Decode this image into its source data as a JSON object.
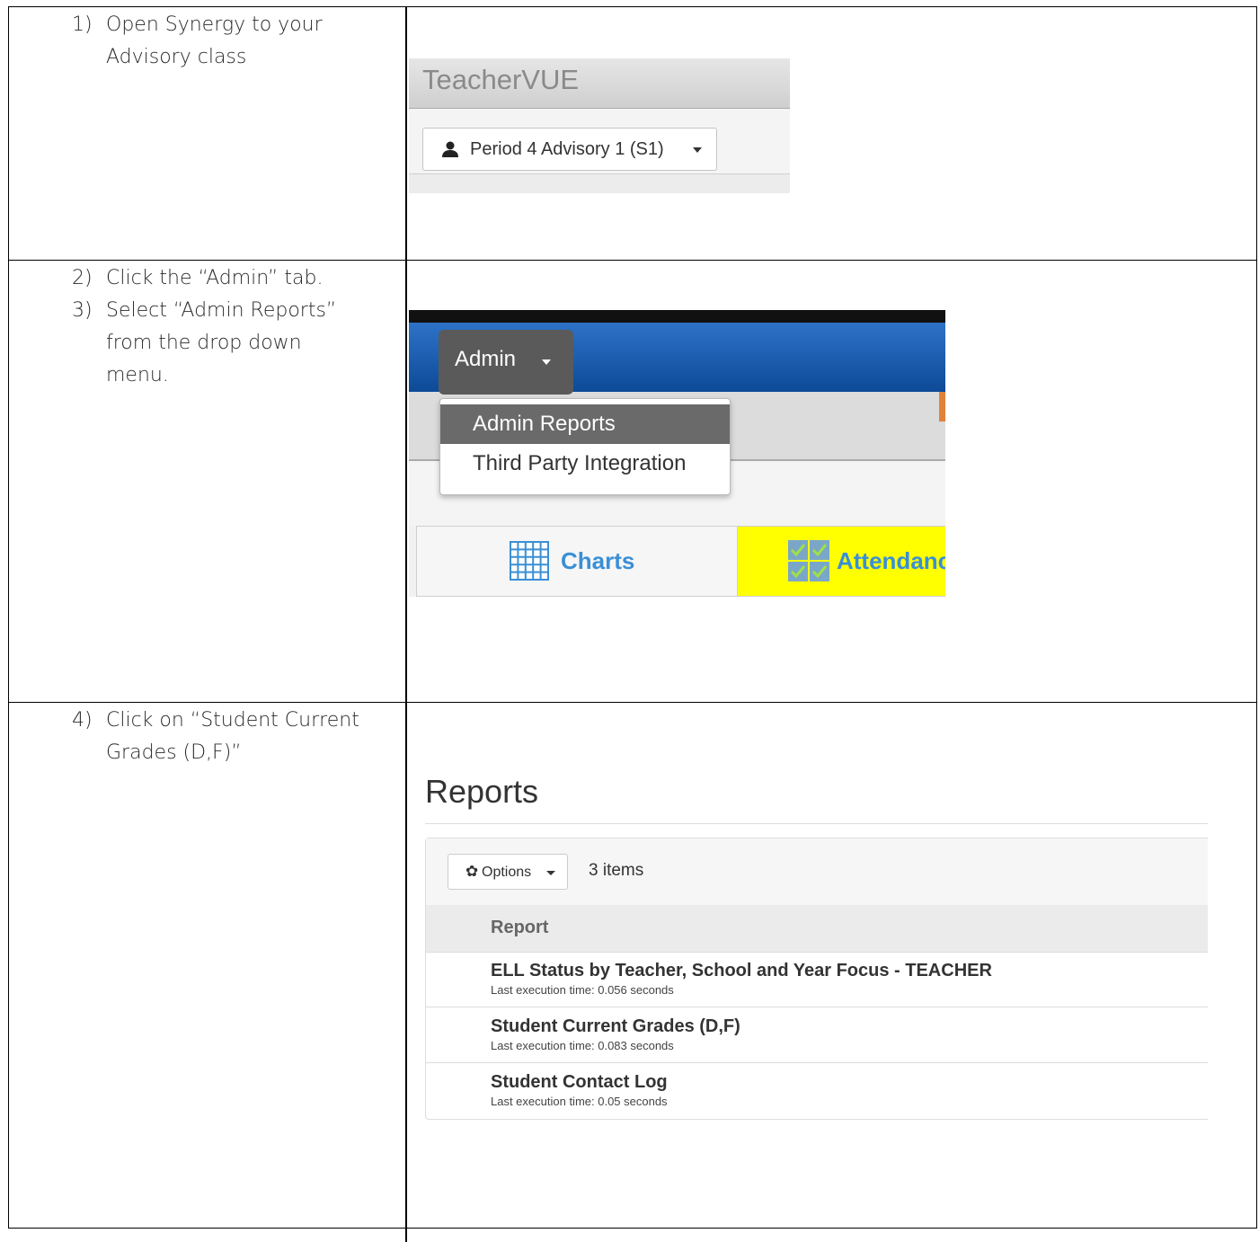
{
  "rows": [
    {
      "steps": [
        {
          "num": "1)",
          "lines": [
            "Open Synergy to your",
            "Advisory class"
          ]
        }
      ]
    },
    {
      "steps": [
        {
          "num": "2)",
          "lines": [
            "Click the “Admin” tab."
          ]
        },
        {
          "num": "3)",
          "lines": [
            "Select “Admin Reports”",
            "from the drop down",
            "menu."
          ]
        }
      ]
    },
    {
      "steps": [
        {
          "num": "4)",
          "lines": [
            "Click on “Student Current",
            "Grades (D,F)”"
          ]
        }
      ]
    }
  ],
  "teachervue": {
    "title": "TeacherVUE",
    "period_selector": "Period 4 Advisory 1 (S1)"
  },
  "admin_menu": {
    "tab_label": "Admin",
    "items": [
      "Admin Reports",
      "Third Party Integration"
    ],
    "highlighted_item": "Admin Reports",
    "tabs": [
      {
        "label": "Charts",
        "icon": "grid-icon"
      },
      {
        "label": "Attendanc",
        "icon": "checklist-icon"
      }
    ],
    "colors": {
      "navbar": "#1a5cb0",
      "highlight": "#ffff00",
      "tab_text": "#3a8fd6"
    }
  },
  "reports": {
    "title": "Reports",
    "options_label": "Options",
    "item_count": "3 items",
    "column_header": "Report",
    "rows": [
      {
        "title": "ELL Status by Teacher, School and Year Focus - TEACHER",
        "meta": "Last execution time: 0.056 seconds"
      },
      {
        "title": "Student Current Grades (D,F)",
        "meta": "Last execution time: 0.083 seconds"
      },
      {
        "title": "Student Contact Log",
        "meta": "Last execution time: 0.05 seconds"
      }
    ]
  }
}
